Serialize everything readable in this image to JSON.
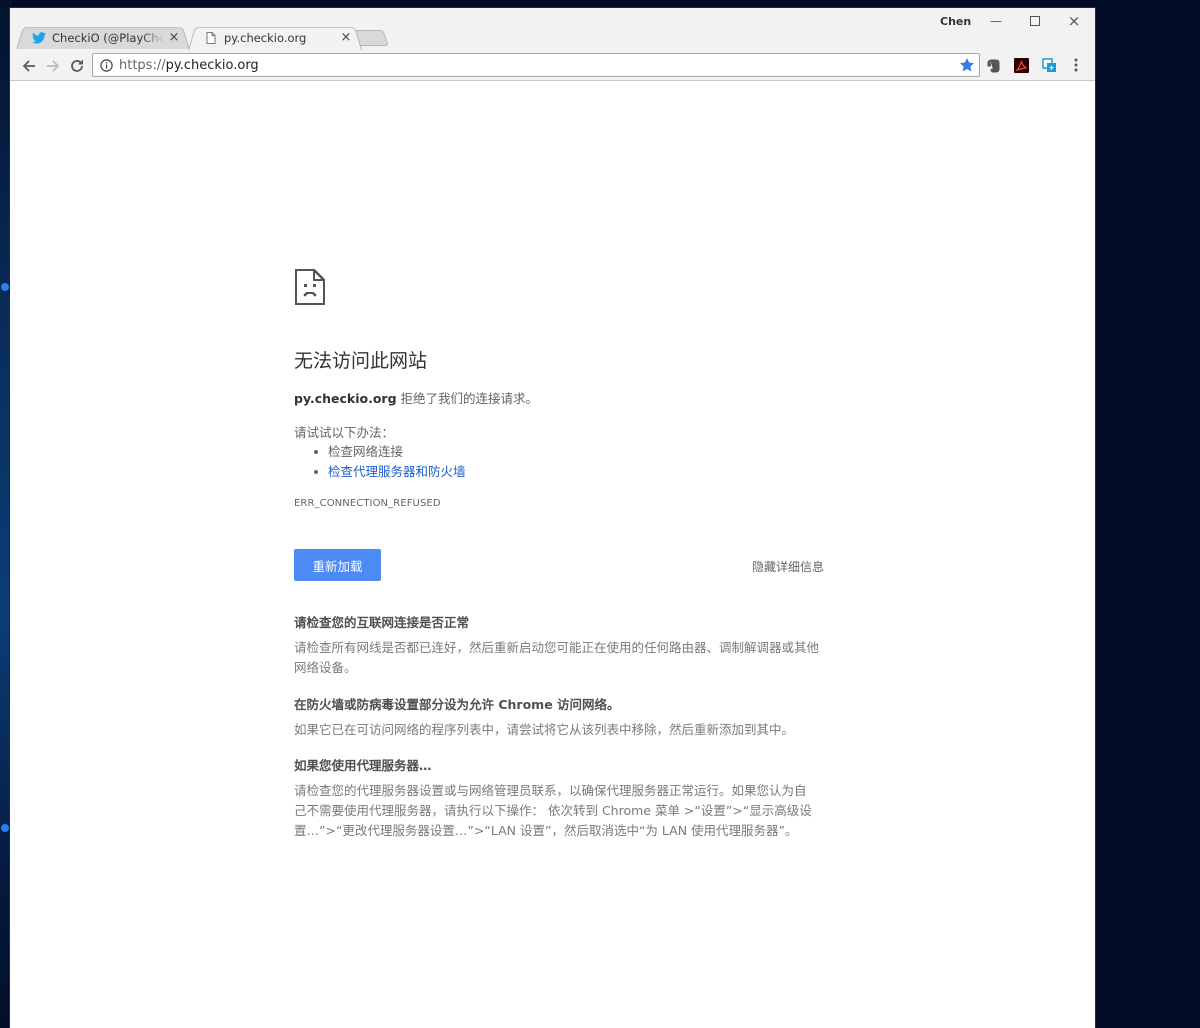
{
  "browser": {
    "tabs": [
      {
        "title": "CheckiO (@PlayCheckiO",
        "favicon": "twitter-bird-icon",
        "active": false
      },
      {
        "title": "py.checkio.org",
        "favicon": "page-icon",
        "active": true
      }
    ],
    "profile_name": "Chen",
    "address": {
      "scheme": "https://",
      "host": "py.checkio.org"
    },
    "icons": {
      "back": "back-arrow-icon",
      "forward": "forward-arrow-icon",
      "reload": "reload-icon",
      "info": "info-icon",
      "bookmark": "bookmark-star-icon",
      "extensions": [
        "evernote-icon",
        "acrobat-icon",
        "translate-icon"
      ],
      "menu": "menu-dots-icon"
    },
    "colors": {
      "accent": "#4c8bf5",
      "star": "#3b78e7"
    }
  },
  "error_page": {
    "icon": "sad-document-icon",
    "headline": "无法访问此网站",
    "summary_host": "py.checkio.org",
    "summary_text": " 拒绝了我们的连接请求。",
    "try_label": "请试试以下办法：",
    "suggestions": [
      {
        "text": "检查网络连接",
        "link": false
      },
      {
        "text": "检查代理服务器和防火墙",
        "link": true
      }
    ],
    "error_code": "ERR_CONNECTION_REFUSED",
    "reload_label": "重新加载",
    "details_label": "隐藏详细信息",
    "details": [
      {
        "title": "请检查您的互联网连接是否正常",
        "body": "请检查所有网线是否都已连好，然后重新启动您可能正在使用的任何路由器、调制解调器或其他网络设备。"
      },
      {
        "title": "在防火墙或防病毒设置部分设为允许 Chrome 访问网络。",
        "body": "如果它已在可访问网络的程序列表中，请尝试将它从该列表中移除，然后重新添加到其中。"
      },
      {
        "title": "如果您使用代理服务器…",
        "body": "请检查您的代理服务器设置或与网络管理员联系，以确保代理服务器正常运行。如果您认为自己不需要使用代理服务器，请执行以下操作： 依次转到 Chrome 菜单 >“设置”>“显示高级设置…”>“更改代理服务器设置…”>“LAN 设置”，然后取消选中“为 LAN 使用代理服务器”。"
      }
    ]
  }
}
